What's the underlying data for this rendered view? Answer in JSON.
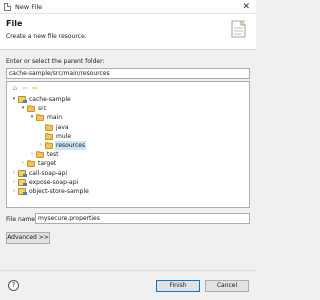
{
  "window": {
    "title": "New File"
  },
  "banner": {
    "heading": "File",
    "description": "Create a new file resource."
  },
  "parent_folder": {
    "label": "Enter or select the parent folder:",
    "value": "cache-sample/src/main/resources"
  },
  "tree": {
    "rows": [
      {
        "label": "cache-sample",
        "toggle": "expanded",
        "icon": "project-icon"
      },
      {
        "label": "src",
        "toggle": "expanded",
        "icon": "folder-icon"
      },
      {
        "label": "main",
        "toggle": "expanded",
        "icon": "folder-icon"
      },
      {
        "label": "java",
        "toggle": "none",
        "icon": "folder-icon"
      },
      {
        "label": "mule",
        "toggle": "none",
        "icon": "folder-icon"
      },
      {
        "label": "resources",
        "toggle": "collapsed",
        "icon": "folder-icon",
        "selected": true
      },
      {
        "label": "test",
        "toggle": "collapsed",
        "icon": "folder-icon"
      },
      {
        "label": "target",
        "toggle": "collapsed",
        "icon": "folder-icon"
      },
      {
        "label": "call-soap-api",
        "toggle": "collapsed",
        "icon": "project-icon"
      },
      {
        "label": "expose-soap-api",
        "toggle": "collapsed",
        "icon": "project-icon"
      },
      {
        "label": "object-store-sample",
        "toggle": "collapsed",
        "icon": "project-icon"
      }
    ]
  },
  "file_name": {
    "label": "File name:",
    "value": "mysecure.properties"
  },
  "buttons": {
    "advanced": "Advanced >>",
    "finish": "Finish",
    "cancel": "Cancel",
    "help": "?"
  }
}
